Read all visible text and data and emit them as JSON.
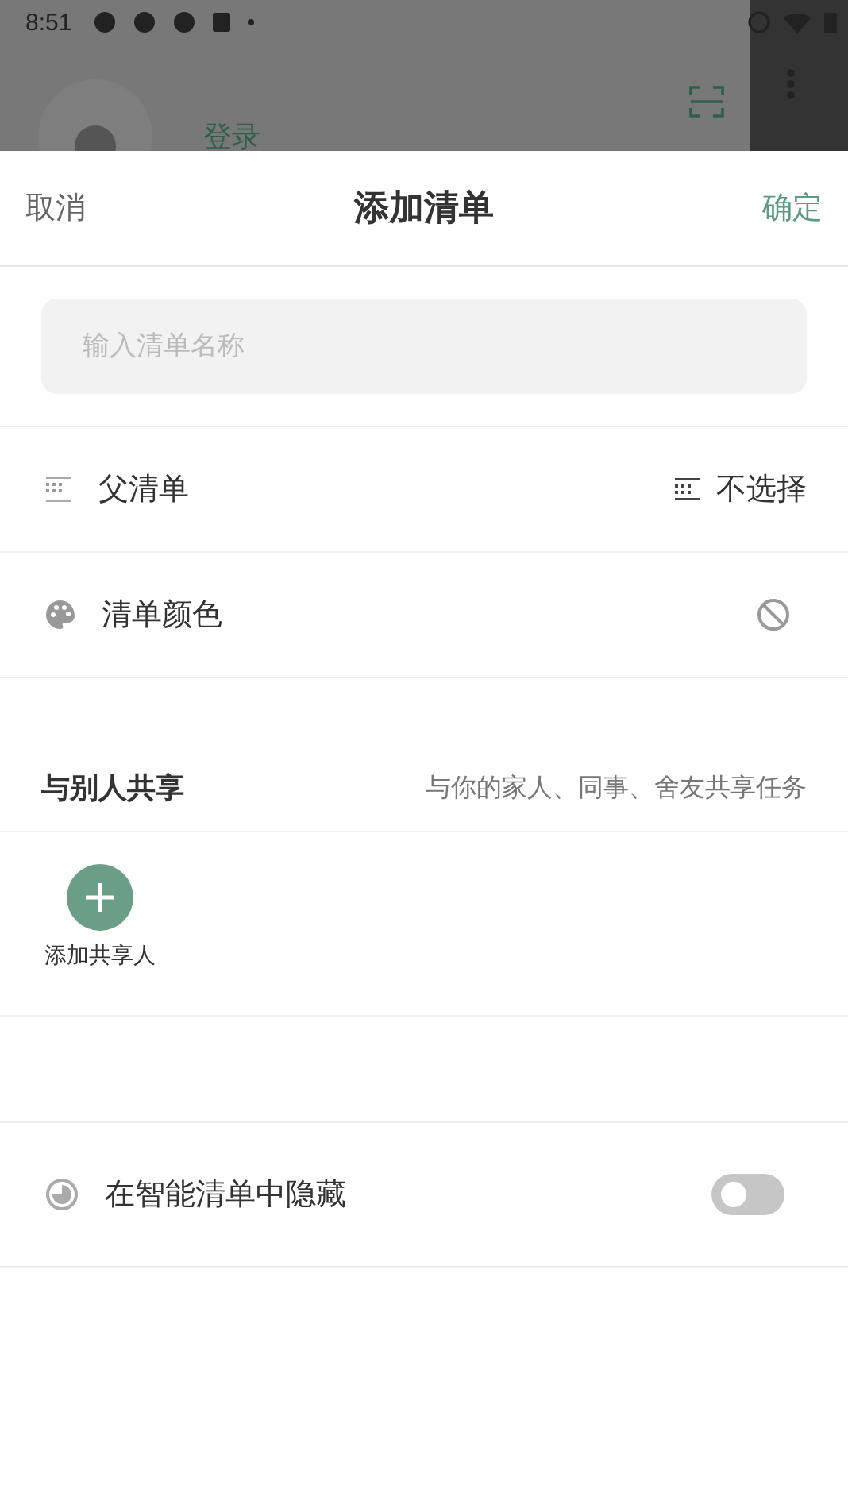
{
  "status_bar": {
    "time": "8:51"
  },
  "background": {
    "login": "登录"
  },
  "sheet": {
    "cancel": "取消",
    "title": "添加清单",
    "confirm": "确定"
  },
  "name_field": {
    "placeholder": "输入清单名称"
  },
  "parent_list": {
    "label": "父清单",
    "value": "不选择"
  },
  "list_color": {
    "label": "清单颜色"
  },
  "share": {
    "title": "与别人共享",
    "hint": "与你的家人、同事、舍友共享任务",
    "add_label": "添加共享人"
  },
  "hide_in_smart": {
    "label": "在智能清单中隐藏",
    "on": false
  }
}
